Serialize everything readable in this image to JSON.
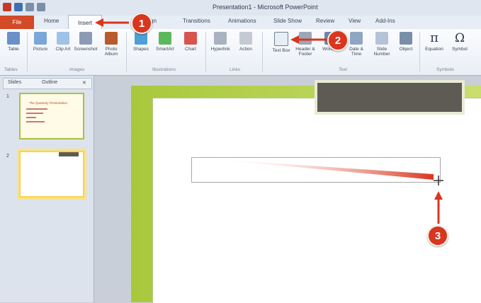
{
  "window": {
    "title": "Presentation1 - Microsoft PowerPoint"
  },
  "ribbon_tabs": [
    "File",
    "Home",
    "Insert",
    "Design",
    "Transitions",
    "Animations",
    "Slide Show",
    "Review",
    "View",
    "Add-Ins"
  ],
  "ribbon": {
    "buttons": [
      "Table",
      "Picture",
      "Clip Art",
      "Screenshot",
      "Photo Album",
      "Shapes",
      "SmartArt",
      "Chart",
      "Hyperlink",
      "Action",
      "Text Box",
      "Header & Footer",
      "WordArt",
      "Date & Time",
      "Slide Number",
      "Object",
      "Equation",
      "Symbol"
    ],
    "groups": [
      "Tables",
      "Images",
      "Illustrations",
      "Links",
      "Text",
      "Symbols"
    ]
  },
  "panel": {
    "tabs": [
      "Slides",
      "Outline"
    ],
    "close_glyph": "✕",
    "slides": [
      {
        "number": "1",
        "title": "The Quarterly Presentation"
      },
      {
        "number": "2"
      }
    ]
  },
  "callouts": [
    "1",
    "2",
    "3"
  ],
  "colors": {
    "accent": "#d9351f",
    "file_tab": "#d24a26",
    "slide_border": "#a8c83c"
  },
  "icons": [
    "save-icon",
    "undo-icon",
    "redo-icon",
    "crosshair-cursor-icon"
  ]
}
